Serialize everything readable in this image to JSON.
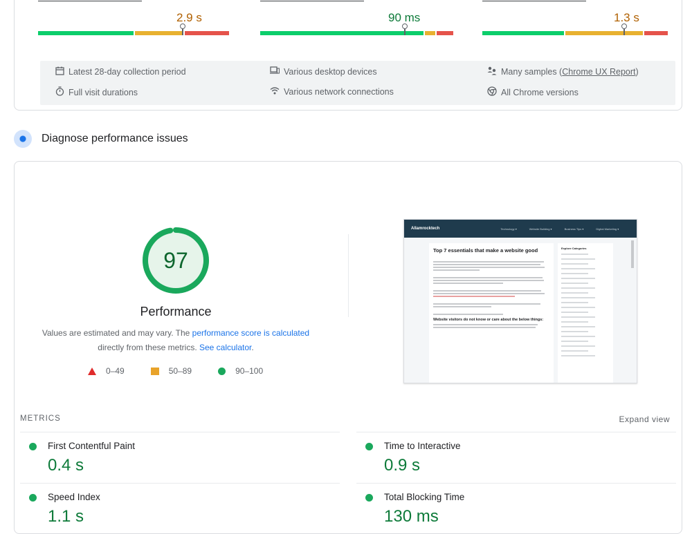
{
  "field_data": {
    "metrics": [
      {
        "value": "2.9 s",
        "value_color": "#b06000"
      },
      {
        "value": "90 ms",
        "value_color": "#0d7a39"
      },
      {
        "value": "1.3 s",
        "value_color": "#b06000"
      }
    ],
    "info": [
      {
        "icon": "calendar-icon",
        "text": "Latest 28-day collection period"
      },
      {
        "icon": "desktop-icon",
        "text": "Various desktop devices"
      },
      {
        "icon": "users-icon",
        "text_before": "Many samples (",
        "link": "Chrome UX Report",
        "text_after": ")"
      },
      {
        "icon": "stopwatch-icon",
        "text": "Full visit durations"
      },
      {
        "icon": "wifi-icon",
        "text": "Various network connections"
      },
      {
        "icon": "chrome-icon",
        "text": "All Chrome versions"
      }
    ]
  },
  "diagnose": {
    "title": "Diagnose performance issues"
  },
  "performance": {
    "score": "97",
    "score_fraction": 0.97,
    "title": "Performance",
    "desc_part1": "Values are estimated and may vary. The ",
    "desc_link1": "performance score is calculated",
    "desc_part2": " directly from these metrics. ",
    "desc_link2": "See calculator",
    "desc_part3": ".",
    "legend": [
      {
        "shape": "triangle",
        "label": "0–49"
      },
      {
        "shape": "square",
        "label": "50–89"
      },
      {
        "shape": "circle",
        "label": "90–100"
      }
    ]
  },
  "thumbnail": {
    "logo": "Allamrocktech",
    "nav": [
      "Technology ▾",
      "Website Building ▾",
      "Business Tips ▾",
      "Digital Marketing ▾"
    ],
    "heading": "Top 7 essentials that make a website good",
    "subheading": "Website visitors do not know or care about the below things:",
    "sidebar_heading": "Explore Categories"
  },
  "metrics": {
    "title": "METRICS",
    "expand": "Expand view",
    "items": [
      {
        "name": "First Contentful Paint",
        "value": "0.4 s"
      },
      {
        "name": "Time to Interactive",
        "value": "0.9 s"
      },
      {
        "name": "Speed Index",
        "value": "1.1 s"
      },
      {
        "name": "Total Blocking Time",
        "value": "130 ms"
      }
    ]
  },
  "colors": {
    "good": "#0cce6b",
    "average": "#ffa400",
    "poor": "#ff4e42",
    "link": "#1a73e8"
  }
}
